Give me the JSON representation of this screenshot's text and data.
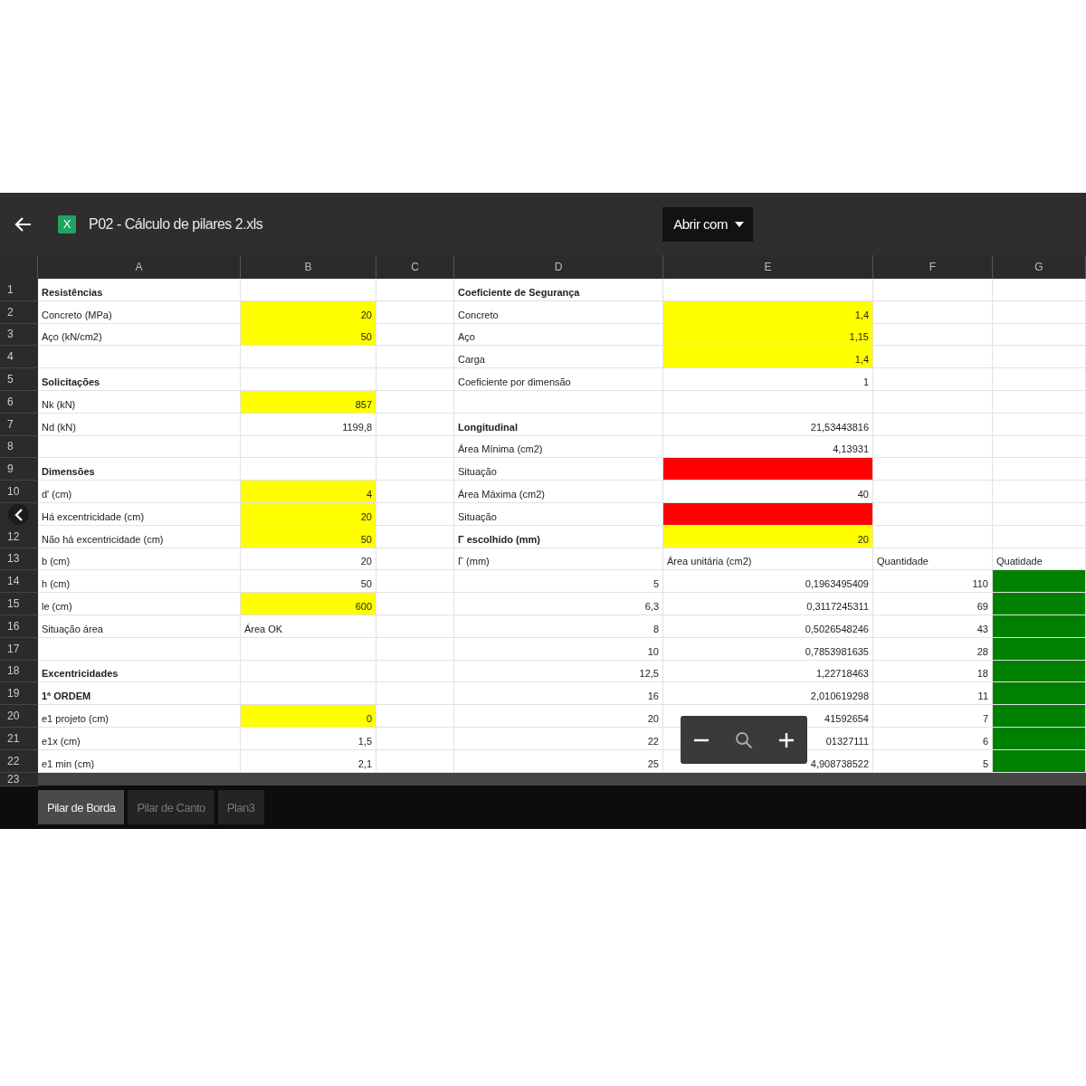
{
  "header": {
    "file_icon_letter": "X",
    "file_name": "P02 - Cálculo de pilares 2.xls",
    "open_button": "Abrir com"
  },
  "columns": [
    "A",
    "B",
    "C",
    "D",
    "E",
    "F",
    "G"
  ],
  "rows": [
    {
      "number": "1",
      "a": {
        "text": "Resistências",
        "bold": true
      },
      "d": {
        "text": "Coeficiente de Segurança",
        "bold": true
      }
    },
    {
      "number": "2",
      "a": {
        "text": "Concreto (MPa)"
      },
      "b": {
        "text": "20",
        "numeric": true,
        "color": "#ffff00"
      },
      "d": {
        "text": "Concreto"
      },
      "e": {
        "text": "1,4",
        "numeric": true,
        "color": "#ffff00"
      }
    },
    {
      "number": "3",
      "a": {
        "text": "Aço (kN/cm2)"
      },
      "b": {
        "text": "50",
        "numeric": true,
        "color": "#ffff00"
      },
      "d": {
        "text": "Aço"
      },
      "e": {
        "text": "1,15",
        "numeric": true,
        "color": "#ffff00"
      }
    },
    {
      "number": "4",
      "d": {
        "text": "Carga"
      },
      "e": {
        "text": "1,4",
        "numeric": true,
        "color": "#ffff00"
      }
    },
    {
      "number": "5",
      "a": {
        "text": "Solicitações",
        "bold": true
      },
      "d": {
        "text": "Coeficiente por dimensão"
      },
      "e": {
        "text": "1",
        "numeric": true
      }
    },
    {
      "number": "6",
      "a": {
        "text": "Nk (kN)"
      },
      "b": {
        "text": "857",
        "numeric": true,
        "color": "#ffff00"
      }
    },
    {
      "number": "7",
      "a": {
        "text": "Nd (kN)"
      },
      "b": {
        "text": "1199,8",
        "numeric": true
      },
      "d": {
        "text": "Longitudinal",
        "bold": true
      },
      "e": {
        "text": "21,53443816",
        "numeric": true
      }
    },
    {
      "number": "8",
      "d": {
        "text": "Área Mínima (cm2)"
      },
      "e": {
        "text": "4,13931",
        "numeric": true
      }
    },
    {
      "number": "9",
      "a": {
        "text": "Dimensões",
        "bold": true
      },
      "d": {
        "text": "Situação"
      },
      "e": {
        "color": "#ff0000"
      }
    },
    {
      "number": "10",
      "a": {
        "text": "d' (cm)"
      },
      "b": {
        "text": "4",
        "numeric": true,
        "color": "#ffff00"
      },
      "d": {
        "text": "Área Máxima (cm2)"
      },
      "e": {
        "text": "40",
        "numeric": true
      }
    },
    {
      "a": {
        "text": "Há excentricidade (cm)"
      },
      "b": {
        "text": "20",
        "numeric": true,
        "color": "#ffff00"
      },
      "d": {
        "text": "Situação"
      },
      "e": {
        "color": "#ff0000"
      }
    },
    {
      "number": "12",
      "a": {
        "text": "Não há excentricidade (cm)"
      },
      "b": {
        "text": "50",
        "numeric": true,
        "color": "#ffff00"
      },
      "d": {
        "text": "Γ escolhido (mm)",
        "bold": true
      },
      "e": {
        "text": "20",
        "numeric": true,
        "color": "#ffff00"
      }
    },
    {
      "number": "13",
      "a": {
        "text": "b (cm)"
      },
      "b": {
        "text": "20",
        "numeric": true
      },
      "d": {
        "text": "Γ (mm)"
      },
      "e": {
        "text": "Área unitária (cm2)"
      },
      "f": {
        "text": "Quantidade"
      },
      "g": {
        "text": "Quatidade"
      }
    },
    {
      "number": "14",
      "a": {
        "text": "h (cm)"
      },
      "b": {
        "text": "50",
        "numeric": true
      },
      "d": {
        "text": "5",
        "numeric": true
      },
      "e": {
        "text": "0,1963495409",
        "numeric": true
      },
      "f": {
        "text": "110",
        "numeric": true
      },
      "g": {
        "color": "#008000"
      }
    },
    {
      "number": "15",
      "a": {
        "text": "le (cm)"
      },
      "b": {
        "text": "600",
        "numeric": true,
        "color": "#ffff00"
      },
      "d": {
        "text": "6,3",
        "numeric": true
      },
      "e": {
        "text": "0,3117245311",
        "numeric": true
      },
      "f": {
        "text": "69",
        "numeric": true
      },
      "g": {
        "color": "#008000"
      }
    },
    {
      "number": "16",
      "a": {
        "text": "Situação área"
      },
      "b": {
        "text": "Área OK"
      },
      "d": {
        "text": "8",
        "numeric": true
      },
      "e": {
        "text": "0,5026548246",
        "numeric": true
      },
      "f": {
        "text": "43",
        "numeric": true
      },
      "g": {
        "color": "#008000"
      }
    },
    {
      "number": "17",
      "d": {
        "text": "10",
        "numeric": true
      },
      "e": {
        "text": "0,7853981635",
        "numeric": true
      },
      "f": {
        "text": "28",
        "numeric": true
      },
      "g": {
        "color": "#008000"
      }
    },
    {
      "number": "18",
      "a": {
        "text": "Excentricidades",
        "bold": true
      },
      "d": {
        "text": "12,5",
        "numeric": true
      },
      "e": {
        "text": "1,22718463",
        "numeric": true
      },
      "f": {
        "text": "18",
        "numeric": true
      },
      "g": {
        "color": "#008000"
      }
    },
    {
      "number": "19",
      "a": {
        "text": "1ª ORDEM",
        "bold": true
      },
      "d": {
        "text": "16",
        "numeric": true
      },
      "e": {
        "text": "2,010619298",
        "numeric": true
      },
      "f": {
        "text": "11",
        "numeric": true
      },
      "g": {
        "color": "#008000"
      }
    },
    {
      "number": "20",
      "a": {
        "text": "e1 projeto (cm)"
      },
      "b": {
        "text": "0",
        "numeric": true,
        "color": "#ffff00"
      },
      "d": {
        "text": "20",
        "numeric": true
      },
      "e": {
        "text": "41592654",
        "numeric": true
      },
      "f": {
        "text": "7",
        "numeric": true
      },
      "g": {
        "color": "#008000"
      }
    },
    {
      "number": "21",
      "a": {
        "text": "e1x (cm)"
      },
      "b": {
        "text": "1,5",
        "numeric": true
      },
      "d": {
        "text": "22",
        "numeric": true
      },
      "e": {
        "text": "01327111",
        "numeric": true
      },
      "f": {
        "text": "6",
        "numeric": true
      },
      "g": {
        "color": "#008000"
      }
    },
    {
      "number": "22",
      "a": {
        "text": "e1 min (cm)"
      },
      "b": {
        "text": "2,1",
        "numeric": true
      },
      "d": {
        "text": "25",
        "numeric": true
      },
      "e": {
        "text": "4,908738522",
        "numeric": true
      },
      "f": {
        "text": "5",
        "numeric": true
      },
      "g": {
        "color": "#008000"
      }
    },
    {
      "number": "23",
      "kind": "partial"
    }
  ],
  "sheet_tabs": [
    {
      "label": "Pilar de Borda",
      "selected": true
    },
    {
      "label": "Pilar de Canto",
      "selected": false
    },
    {
      "label": "Plan3",
      "selected": false
    }
  ]
}
